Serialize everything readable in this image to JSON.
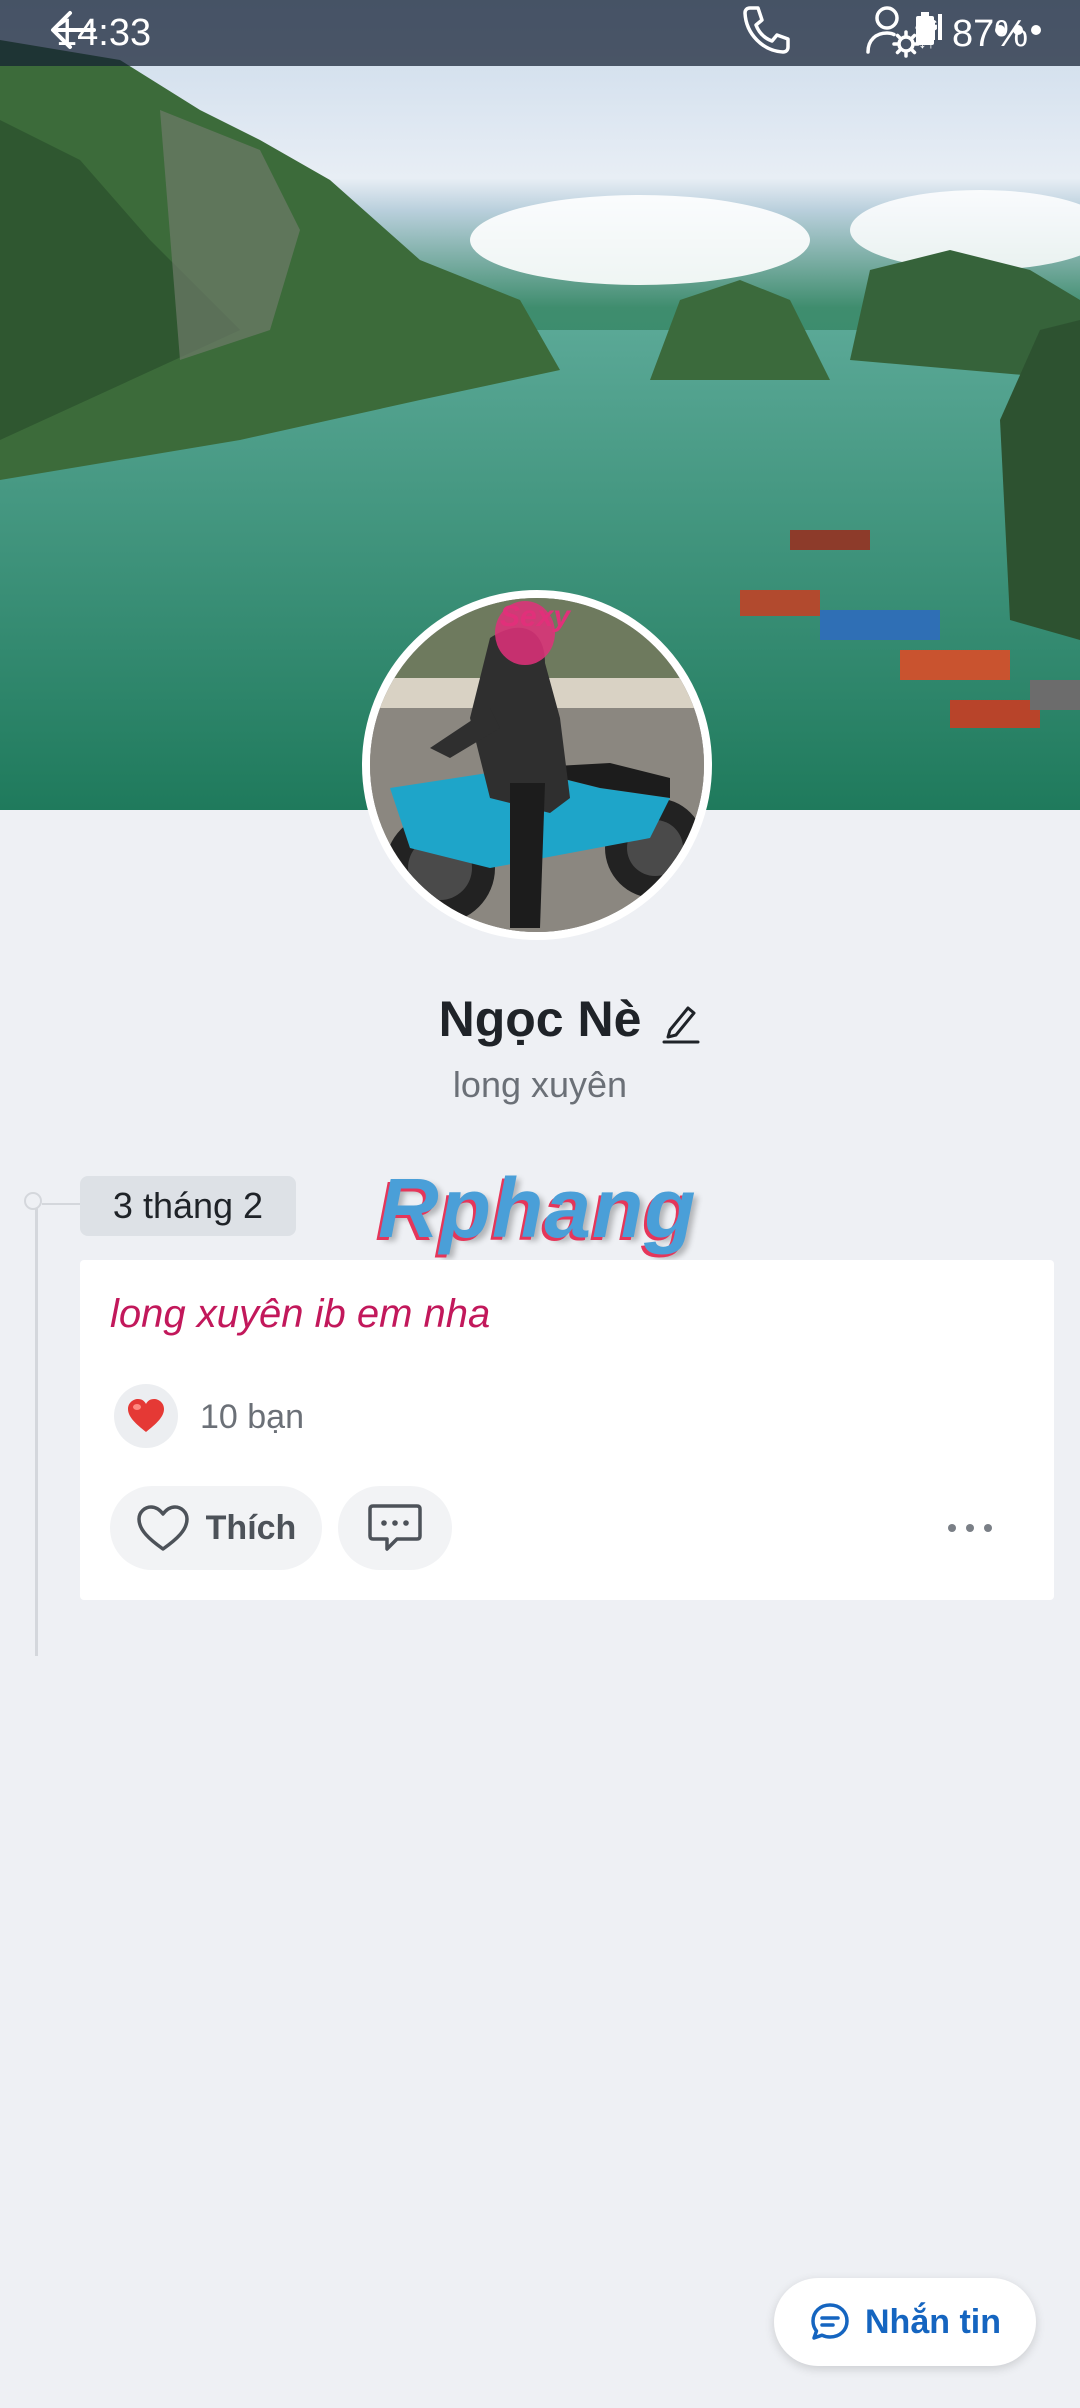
{
  "status_bar": {
    "time": "14:33",
    "network": "4G",
    "battery": "87%"
  },
  "toolbar": {
    "back_icon": "back-arrow-icon",
    "call_icon": "phone-icon",
    "settings_icon": "user-settings-icon",
    "more_icon": "more-icon"
  },
  "avatar": {
    "sticker_text": "Sexy"
  },
  "profile": {
    "name": "Ngọc Nè",
    "location": "long xuyên"
  },
  "timeline": {
    "date": "3 tháng 2",
    "watermark": "Rphang"
  },
  "post": {
    "text": "long xuyên ib em nha",
    "reaction_count": "10 bạn",
    "like_label": "Thích"
  },
  "fab": {
    "label": "Nhắn tin"
  },
  "colors": {
    "accent": "#1565c0",
    "post_text": "#c2185b",
    "heart": "#e53935"
  }
}
